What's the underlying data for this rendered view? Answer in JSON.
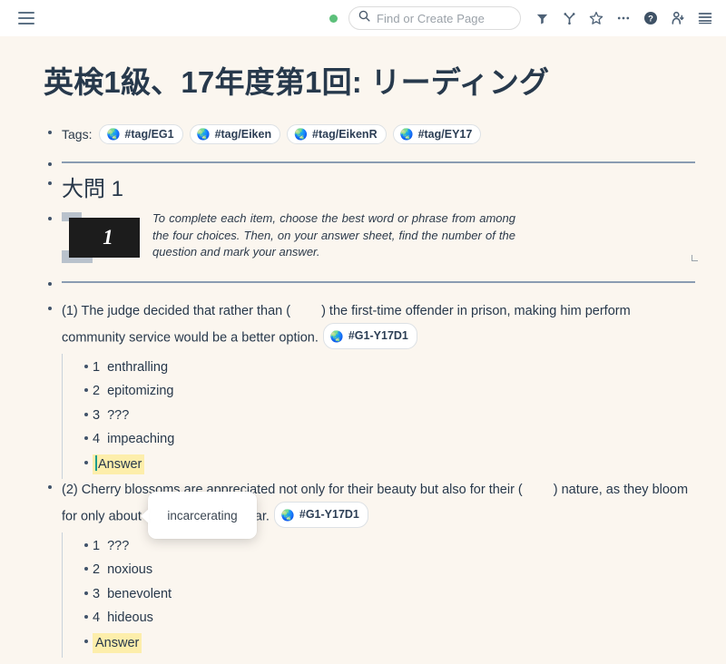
{
  "topbar": {
    "menu_icon": "hamburger-icon",
    "status_dot_color": "#5cc07a",
    "search_placeholder": "Find or Create Page",
    "search_icon": "search-icon",
    "tools": [
      {
        "name": "filter-icon",
        "label": "Filter"
      },
      {
        "name": "graph-branch-icon",
        "label": "Graph"
      },
      {
        "name": "star-icon",
        "label": "Favorite"
      },
      {
        "name": "more-dots-icon",
        "label": "More"
      },
      {
        "name": "help-icon",
        "label": "Help"
      },
      {
        "name": "add-person-icon",
        "label": "Share"
      },
      {
        "name": "right-sidebar-icon",
        "label": "Toggle right sidebar"
      }
    ]
  },
  "page": {
    "title": "英検1級、17年度第1回: リーディング",
    "tags_label": "Tags:",
    "tags": [
      {
        "icon": "🌏",
        "label": "#tag/EG1"
      },
      {
        "icon": "🌏",
        "label": "#tag/Eiken"
      },
      {
        "icon": "🌏",
        "label": "#tag/EikenR"
      },
      {
        "icon": "🌏",
        "label": "#tag/EY17"
      }
    ],
    "section_heading": "大問 1",
    "instruction": {
      "number_badge": "1",
      "text": "To complete each item, choose the best word or phrase from among the four choices. Then, on your answer sheet, find the number of the question and mark your answer."
    },
    "questions": [
      {
        "number": "(1)",
        "text_before_gap": "The judge decided that rather than (",
        "text_after_gap": ") the first-time offender in prison, making him perform community service would be a better option.",
        "pill": {
          "icon": "🌏",
          "label": "#G1-Y17D1"
        },
        "choices": [
          "1  enthralling",
          "2  epitomizing",
          "3  ???",
          "4  impeaching"
        ],
        "answer_label": "Answer",
        "answer_selected": true
      },
      {
        "number": "(2)",
        "text_before_gap": "Cherry blossoms are appreciated not only for their beauty but also for their (",
        "text_after_gap": ") nature, as they bloom for only about one week every year.",
        "pill": {
          "icon": "🌏",
          "label": "#G1-Y17D1"
        },
        "choices": [
          "1  ???",
          "2  noxious",
          "3  benevolent",
          "4  hideous"
        ],
        "answer_label": "Answer",
        "answer_selected": false
      }
    ]
  },
  "tooltip": {
    "text": "incarcerating"
  },
  "colors": {
    "page_background": "#fbf6ef",
    "topbar_background": "#ffffff",
    "text": "#27384b",
    "divider": "#8a9cb2",
    "highlight": "#fdeeab",
    "caret": "#1a9c8f",
    "accent_dot": "#5cc07a"
  }
}
